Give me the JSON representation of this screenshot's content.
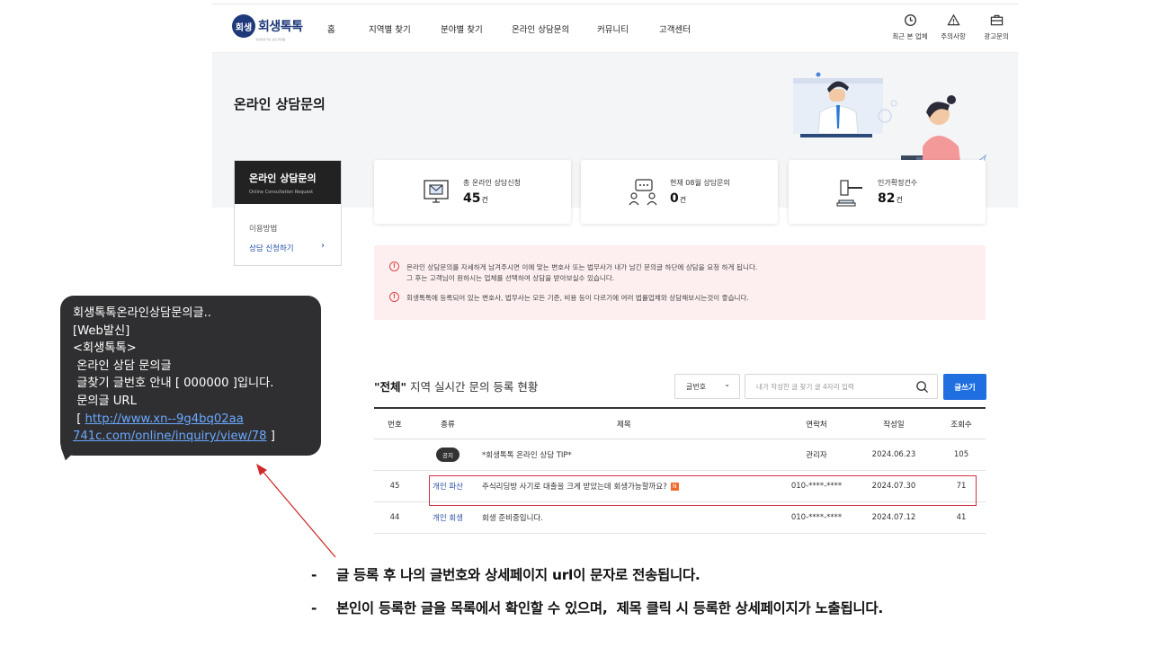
{
  "header": {
    "logo_mark": "회생",
    "logo_text": "회생톡톡",
    "logo_sub": "개인회생 파산 상담 플랫폼",
    "nav": [
      "홈",
      "지역별 찾기",
      "분야별 찾기",
      "온라인 상담문의",
      "커뮤니티",
      "고객센터"
    ],
    "util": [
      {
        "label": "최근 본 업체",
        "icon": "clock-icon"
      },
      {
        "label": "주의사항",
        "icon": "warning-icon"
      },
      {
        "label": "광고문의",
        "icon": "briefcase-icon"
      }
    ]
  },
  "banner": {
    "title": "온라인 상담문의"
  },
  "side_menu": {
    "title": "온라인 상담문의",
    "subtitle": "Online Consultation Request",
    "items": [
      {
        "label": "이용방법"
      },
      {
        "label": "상담 신청하기",
        "chevron": "›"
      }
    ]
  },
  "stats": [
    {
      "label": "총 온라인 상담신청",
      "value": "45",
      "unit": "건",
      "icon": "monitor-mail-icon"
    },
    {
      "label": "현재 08월 상담문의",
      "value": "0",
      "unit": "건",
      "icon": "chat-people-icon"
    },
    {
      "label": "인가확정건수",
      "value": "82",
      "unit": "건",
      "icon": "gavel-icon"
    }
  ],
  "notice": {
    "line1": "온라인 상담문의를 자세하게 남겨주시면 이에 맞는 변호사 또는 법무사가 내가 남긴 문의글 하단에 상담을 요청 하게 됩니다.",
    "line2": "그 후는 고객님이 원하시는 업체를 선택하여 상담을 받아보실수 있습니다.",
    "line3": "회생톡톡에 등록되어 있는 변호사, 법무사는 모든 기준, 비용 등이 다르기에 여러 법률업체와 상담해보시는것이 좋습니다.",
    "icon_glyph": "!"
  },
  "board": {
    "title_quote": "\"전체\"",
    "title_rest": " 지역 실시간 문의 등록 현황",
    "select_value": "글번호",
    "select_chevron": "⌄",
    "search_placeholder": "내가 작성한 글 찾기 글 4자리 입력",
    "write_label": "글쓰기",
    "columns": {
      "no": "번호",
      "type": "종류",
      "title": "제목",
      "contact": "연락처",
      "date": "작성일",
      "views": "조회수"
    },
    "rows": [
      {
        "no": "",
        "type": "공지",
        "title": "*회생톡톡 온라인 상담 TIP*",
        "contact": "관리자",
        "date": "2024.06.23",
        "views": "105"
      },
      {
        "no": "45",
        "type": "개인 파산",
        "title": "주식리딩방 사기로 대출을 크게 받았는데 회생가능할까요?",
        "new_badge": "N",
        "contact": "010-****-****",
        "date": "2024.07.30",
        "views": "71"
      },
      {
        "no": "44",
        "type": "개인 회생",
        "title": "회생 준비중입니다.",
        "contact": "010-****-****",
        "date": "2024.07.12",
        "views": "41"
      }
    ]
  },
  "sms": {
    "lines": [
      "회생톡톡온라인상담문의글..",
      "[Web발신]",
      "<회생톡톡>",
      " 온라인 상담 문의글",
      " 글찾기 글번호 안내 [ 000000 ]입니다.",
      " 문의글 URL"
    ],
    "url_prefix": " [ ",
    "url_line1": "http://www.xn--9g4bq02aa",
    "url_line2": "741c.com/online/inquiry/view/78",
    "url_suffix": " ]"
  },
  "bullets": {
    "dash": "-",
    "item1": "글 등록 후 나의 글번호와 상세페이지 url이 문자로 전송됩니다.",
    "item2": "본인이 등록한 글을 목록에서 확인할 수 있으며,  제목 클릭 시 등록한 상세페이지가 노출됩니다."
  },
  "colors": {
    "accent": "#1f6fe0",
    "highlight_border": "#cf3244",
    "arrow": "#cf2a2a",
    "notice_bg": "#fdeff0"
  }
}
